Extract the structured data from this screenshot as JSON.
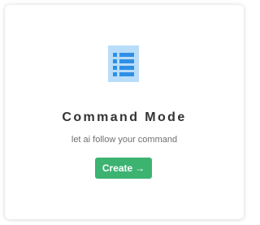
{
  "card": {
    "icon": "list-icon",
    "title": "Command Mode",
    "subtitle": "let ai follow your command",
    "button": {
      "label": "Create",
      "arrow": "→"
    }
  },
  "colors": {
    "icon_background": "#b9ddf8",
    "icon_foreground": "#2f8fe6",
    "button_background": "#3cb371",
    "title_text": "#333333",
    "subtitle_text": "#6f6f6f"
  }
}
